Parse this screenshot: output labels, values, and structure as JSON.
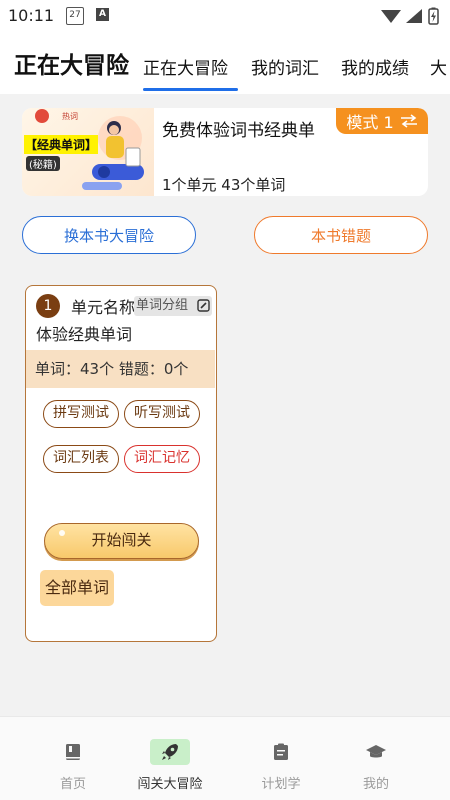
{
  "status_bar": {
    "time": "10:11",
    "calendar_day": "27"
  },
  "header": {
    "app_title": "正在大冒险",
    "tabs": [
      {
        "label": "正在大冒险",
        "active": true
      },
      {
        "label": "我的词汇",
        "active": false
      },
      {
        "label": "我的成绩",
        "active": false
      },
      {
        "label": "大",
        "active": false
      }
    ],
    "accent_color": "#1f6ee8"
  },
  "book": {
    "cover_label": "【经典单词】",
    "cover_sub": "(秘籍)",
    "cover_logo": "热词",
    "title": "免费体验词书经典单",
    "meta": "1个单元   43个单词",
    "mode_label": "模式 1",
    "mode_color": "#f5911f"
  },
  "actions": {
    "switch_book": "换本书大冒险",
    "wrong_words": "本书错题"
  },
  "unit": {
    "number": "1",
    "name_label": "单元名称",
    "group_tag": "单词分组",
    "title": "体验经典单词",
    "stats": "单词：43个   错题：0个",
    "buttons": [
      "拼写测试",
      "听写测试",
      "词汇列表",
      "词汇记忆"
    ],
    "start_label": "开始闯关",
    "all_words_label": "全部单词"
  },
  "bottom_nav": [
    {
      "label": "首页",
      "icon": "book-icon",
      "active": false
    },
    {
      "label": "闯关大冒险",
      "icon": "rocket-icon",
      "active": true
    },
    {
      "label": "计划学",
      "icon": "clipboard-icon",
      "active": false
    },
    {
      "label": "我的",
      "icon": "graduation-cap-icon",
      "active": false
    }
  ]
}
